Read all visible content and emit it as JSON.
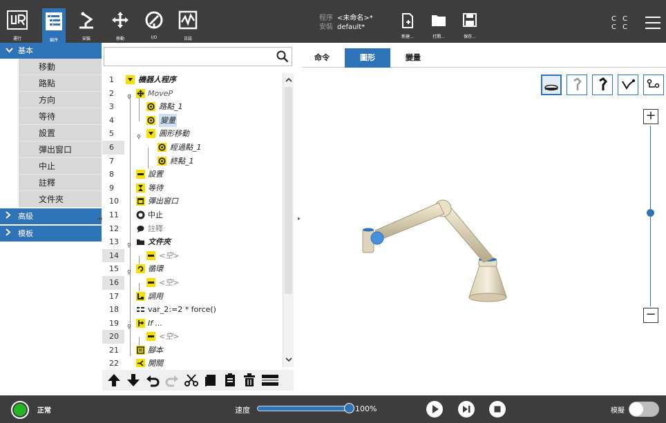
{
  "topbar": {
    "run_label": "運行",
    "program_label": "編序",
    "install_label": "安裝",
    "move_label": "移動",
    "io_label": "I/O",
    "log_label": "日誌",
    "program_key": "程序",
    "program_name": "<未命名>*",
    "install_key": "安裝",
    "install_name": "default*",
    "new_label": "新建...",
    "open_label": "打開...",
    "save_label": "保存...",
    "cc_top": "C C",
    "cc_bottom": "C C"
  },
  "leftnav": {
    "basic": "基本",
    "items": [
      "移動",
      "路點",
      "方向",
      "等待",
      "設置",
      "彈出窗口",
      "中止",
      "註釋",
      "文件夾"
    ],
    "advanced": "高級",
    "templates": "模板"
  },
  "tree": {
    "rows": [
      {
        "n": "1",
        "text": "機器人程序"
      },
      {
        "n": "2",
        "text": "MoveP"
      },
      {
        "n": "3",
        "text": "路點_1"
      },
      {
        "n": "4",
        "text": "變量"
      },
      {
        "n": "5",
        "text": "圓形移動"
      },
      {
        "n": "6",
        "text": "經過點_1"
      },
      {
        "n": "7",
        "text": "終點_1"
      },
      {
        "n": "8",
        "text": "設置"
      },
      {
        "n": "9",
        "text": "等待"
      },
      {
        "n": "10",
        "text": "彈出窗口"
      },
      {
        "n": "11",
        "text": "中止"
      },
      {
        "n": "12",
        "text": "註釋"
      },
      {
        "n": "13",
        "text": "文件夾"
      },
      {
        "n": "14",
        "text": "<空>"
      },
      {
        "n": "15",
        "text": "循環"
      },
      {
        "n": "16",
        "text": "<空>"
      },
      {
        "n": "17",
        "text": "調用"
      },
      {
        "n": "18",
        "text": "var_2:=2 * force()"
      },
      {
        "n": "19",
        "text": "If ..."
      },
      {
        "n": "20",
        "text": "<空>"
      },
      {
        "n": "21",
        "text": "腳本"
      },
      {
        "n": "22",
        "text": "開關"
      }
    ]
  },
  "tabs": [
    "命令",
    "圖形",
    "變量"
  ],
  "bottom": {
    "status": "正常",
    "speed_label": "速度",
    "speed_value": "100%",
    "speed_fraction": 1.0,
    "sim_label": "模擬"
  },
  "colors": {
    "accent": "#2e72b8",
    "bar": "#3d3d3d",
    "status_ok": "#21b521"
  }
}
